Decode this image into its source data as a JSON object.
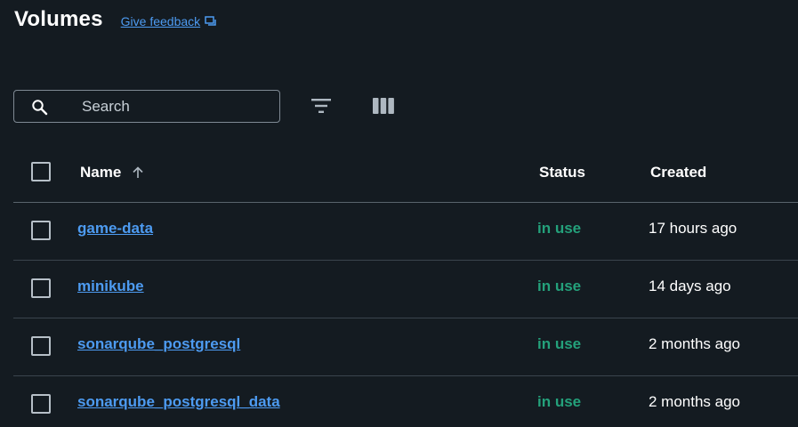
{
  "header": {
    "title": "Volumes",
    "feedback_label": "Give feedback"
  },
  "toolbar": {
    "search_placeholder": "Search",
    "search_icon": "search-icon",
    "filter_icon": "filter-icon",
    "columns_icon": "columns-icon"
  },
  "table": {
    "columns": {
      "name": "Name",
      "status": "Status",
      "created": "Created"
    },
    "sort": "ascending",
    "rows": [
      {
        "name": "game-data",
        "status": "in use",
        "created": "17 hours ago"
      },
      {
        "name": "minikube",
        "status": "in use",
        "created": "14 days ago"
      },
      {
        "name": "sonarqube_postgresql",
        "status": "in use",
        "created": "2 months ago"
      },
      {
        "name": "sonarqube_postgresql_data",
        "status": "in use",
        "created": "2 months ago"
      }
    ]
  },
  "colors": {
    "background": "#141b21",
    "link": "#4d9bf1",
    "status_in_use": "#24a17b",
    "divider": "#3a444d"
  }
}
